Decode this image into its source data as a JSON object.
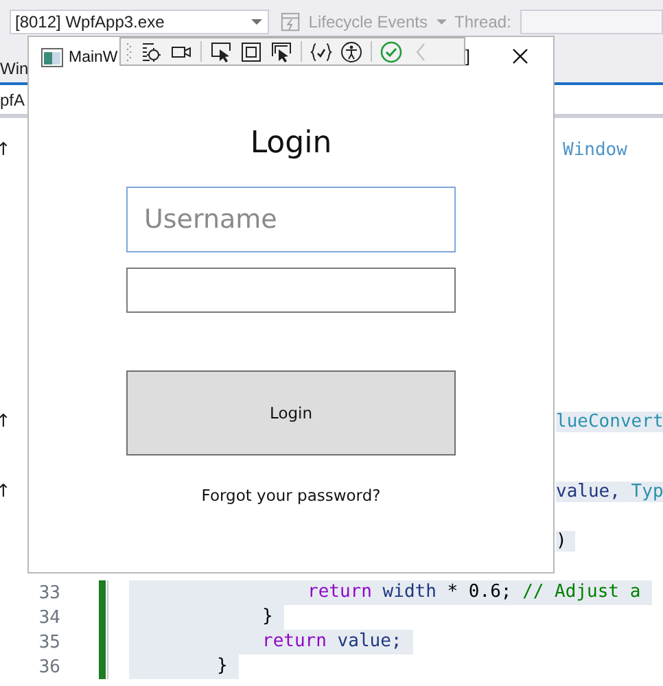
{
  "process_selector": {
    "value": "[8012] WpfApp3.exe"
  },
  "lifecycle_events": {
    "label": "Lifecycle Events"
  },
  "thread": {
    "label": "Thread:"
  },
  "document_tab": {
    "label": "Win"
  },
  "navigation_bar": {
    "value": "pfA"
  },
  "editor": {
    "rows_above": [
      {
        "mark": "↑",
        "tokens": [
          {
            "text": "Window",
            "kind": "xaml"
          }
        ]
      },
      {
        "mark": "↑",
        "tokens": [
          {
            "text": "lueConvert",
            "kind": "type"
          }
        ]
      },
      {
        "mark": "↑",
        "tokens": [
          {
            "text": "value, ",
            "kind": "identifier"
          },
          {
            "text": "Typ",
            "kind": "type"
          }
        ]
      },
      {
        "tokens": [
          {
            "text": ")",
            "kind": "plain"
          }
        ]
      }
    ],
    "lines": [
      {
        "number": "33",
        "tokens": [
          {
            "text": "return ",
            "kind": "keyword"
          },
          {
            "text": "width ",
            "kind": "identifier"
          },
          {
            "text": "* 0.6; ",
            "kind": "plain"
          },
          {
            "text": "// Adjust a",
            "kind": "comment"
          }
        ]
      },
      {
        "number": "34",
        "tokens": [
          {
            "text": "}",
            "kind": "plain"
          }
        ]
      },
      {
        "number": "35",
        "tokens": [
          {
            "text": "return ",
            "kind": "keyword"
          },
          {
            "text": "value;",
            "kind": "identifier"
          }
        ]
      },
      {
        "number": "36",
        "tokens": [
          {
            "text": "}",
            "kind": "plain"
          }
        ]
      }
    ]
  },
  "app_window": {
    "title": "MainW",
    "title_tail": "]",
    "toolbar": [
      {
        "kind": "target",
        "disabled": false
      },
      {
        "kind": "camera",
        "disabled": false
      },
      {
        "kind": "select",
        "disabled": false
      },
      {
        "kind": "square",
        "disabled": false
      },
      {
        "kind": "frame",
        "disabled": false
      },
      {
        "kind": "braces",
        "disabled": false
      },
      {
        "kind": "accessibility",
        "disabled": false
      },
      {
        "kind": "check",
        "disabled": false
      },
      {
        "kind": "back",
        "disabled": true
      }
    ],
    "heading": "Login",
    "username": {
      "placeholder": "Username"
    },
    "login_button": "Login",
    "forgot_link": "Forgot your password?"
  }
}
